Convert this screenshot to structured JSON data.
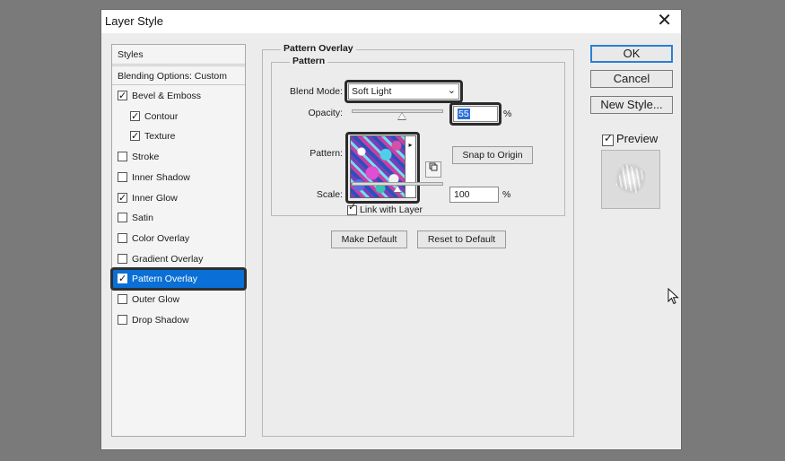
{
  "dialog": {
    "title": "Layer Style",
    "close_glyph": "✕"
  },
  "styles_list": {
    "header": "Styles",
    "blending": "Blending Options: Custom",
    "items": [
      {
        "label": "Bevel & Emboss",
        "checked": true,
        "indent": false
      },
      {
        "label": "Contour",
        "checked": true,
        "indent": true
      },
      {
        "label": "Texture",
        "checked": true,
        "indent": true
      },
      {
        "label": "Stroke",
        "checked": false,
        "indent": false
      },
      {
        "label": "Inner Shadow",
        "checked": false,
        "indent": false
      },
      {
        "label": "Inner Glow",
        "checked": true,
        "indent": false
      },
      {
        "label": "Satin",
        "checked": false,
        "indent": false
      },
      {
        "label": "Color Overlay",
        "checked": false,
        "indent": false
      },
      {
        "label": "Gradient Overlay",
        "checked": false,
        "indent": false
      },
      {
        "label": "Pattern Overlay",
        "checked": true,
        "indent": false,
        "selected": true
      },
      {
        "label": "Outer Glow",
        "checked": false,
        "indent": false
      },
      {
        "label": "Drop Shadow",
        "checked": false,
        "indent": false
      }
    ]
  },
  "pattern_overlay": {
    "section_title": "Pattern Overlay",
    "group_title": "Pattern",
    "blend_mode_label": "Blend Mode:",
    "blend_mode_value": "Soft Light",
    "opacity_label": "Opacity:",
    "opacity_value": "55",
    "opacity_fraction": 0.55,
    "percent": "%",
    "pattern_label": "Pattern:",
    "snap_button": "Snap to Origin",
    "scale_label": "Scale:",
    "scale_value": "100",
    "scale_fraction": 0.5,
    "link_label": "Link with Layer",
    "link_checked": true,
    "make_default": "Make Default",
    "reset_default": "Reset to Default"
  },
  "buttons": {
    "ok": "OK",
    "cancel": "Cancel",
    "new_style": "New Style..."
  },
  "preview": {
    "label": "Preview",
    "checked": true
  },
  "icons": {
    "check": "✓",
    "dropdown": "⌄",
    "flyout": "▸",
    "new_pattern": "new-preset-icon",
    "cursor": "arrow-cursor-icon"
  },
  "colors": {
    "selection": "#0a6fd6",
    "highlight_outline": "#2b2b2b",
    "ok_border": "#2b7fd6"
  }
}
